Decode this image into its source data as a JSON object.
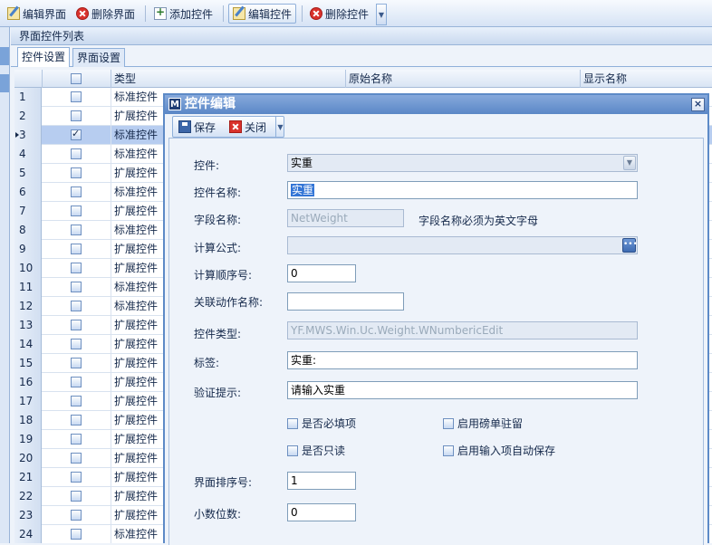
{
  "toolbar": {
    "edit_page": "编辑界面",
    "delete_page": "删除界面",
    "add_control": "添加控件",
    "edit_control": "编辑控件",
    "delete_control": "删除控件"
  },
  "panel": {
    "title": "界面控件列表",
    "tabs": [
      "控件设置",
      "界面设置"
    ]
  },
  "grid": {
    "columns": [
      "类型",
      "原始名称",
      "显示名称"
    ],
    "rows": [
      {
        "num": "1",
        "checked": false,
        "type": "标准控件"
      },
      {
        "num": "2",
        "checked": false,
        "type": "扩展控件"
      },
      {
        "num": "3",
        "checked": true,
        "type": "标准控件",
        "current": true
      },
      {
        "num": "4",
        "checked": false,
        "type": "标准控件"
      },
      {
        "num": "5",
        "checked": false,
        "type": "扩展控件"
      },
      {
        "num": "6",
        "checked": false,
        "type": "标准控件"
      },
      {
        "num": "7",
        "checked": false,
        "type": "扩展控件"
      },
      {
        "num": "8",
        "checked": false,
        "type": "标准控件"
      },
      {
        "num": "9",
        "checked": false,
        "type": "扩展控件"
      },
      {
        "num": "10",
        "checked": false,
        "type": "扩展控件"
      },
      {
        "num": "11",
        "checked": false,
        "type": "标准控件"
      },
      {
        "num": "12",
        "checked": false,
        "type": "标准控件"
      },
      {
        "num": "13",
        "checked": false,
        "type": "扩展控件"
      },
      {
        "num": "14",
        "checked": false,
        "type": "扩展控件"
      },
      {
        "num": "15",
        "checked": false,
        "type": "扩展控件"
      },
      {
        "num": "16",
        "checked": false,
        "type": "扩展控件"
      },
      {
        "num": "17",
        "checked": false,
        "type": "扩展控件"
      },
      {
        "num": "18",
        "checked": false,
        "type": "扩展控件"
      },
      {
        "num": "19",
        "checked": false,
        "type": "扩展控件"
      },
      {
        "num": "20",
        "checked": false,
        "type": "扩展控件"
      },
      {
        "num": "21",
        "checked": false,
        "type": "扩展控件"
      },
      {
        "num": "22",
        "checked": false,
        "type": "扩展控件"
      },
      {
        "num": "23",
        "checked": false,
        "type": "扩展控件"
      },
      {
        "num": "24",
        "checked": false,
        "type": "标准控件"
      }
    ]
  },
  "dialog": {
    "logo": "M",
    "title": "控件编辑",
    "close": "×",
    "save": "保存",
    "close_btn": "关闭",
    "fields": {
      "control_label": "控件:",
      "control_value": "实重",
      "control_name_label": "控件名称:",
      "control_name_value": "实重",
      "field_name_label": "字段名称:",
      "field_name_value": "NetWeight",
      "field_name_note": "字段名称必须为英文字母",
      "formula_label": "计算公式:",
      "formula_value": "",
      "calc_order_label": "计算顺序号:",
      "calc_order_value": "0",
      "action_label": "关联动作名称:",
      "action_value": "",
      "type_label": "控件类型:",
      "type_value": "YF.MWS.Win.Uc.Weight.WNumbericEdit",
      "tag_label": "标签:",
      "tag_value": "实重:",
      "validate_label": "验证提示:",
      "validate_value": "请输入实重",
      "required": "是否必填项",
      "readonly": "是否只读",
      "enable_pound": "启用磅单驻留",
      "enable_autosave": "启用输入项自动保存",
      "sort_label": "界面排序号:",
      "sort_value": "1",
      "decimal_label": "小数位数:",
      "decimal_value": "0"
    }
  }
}
